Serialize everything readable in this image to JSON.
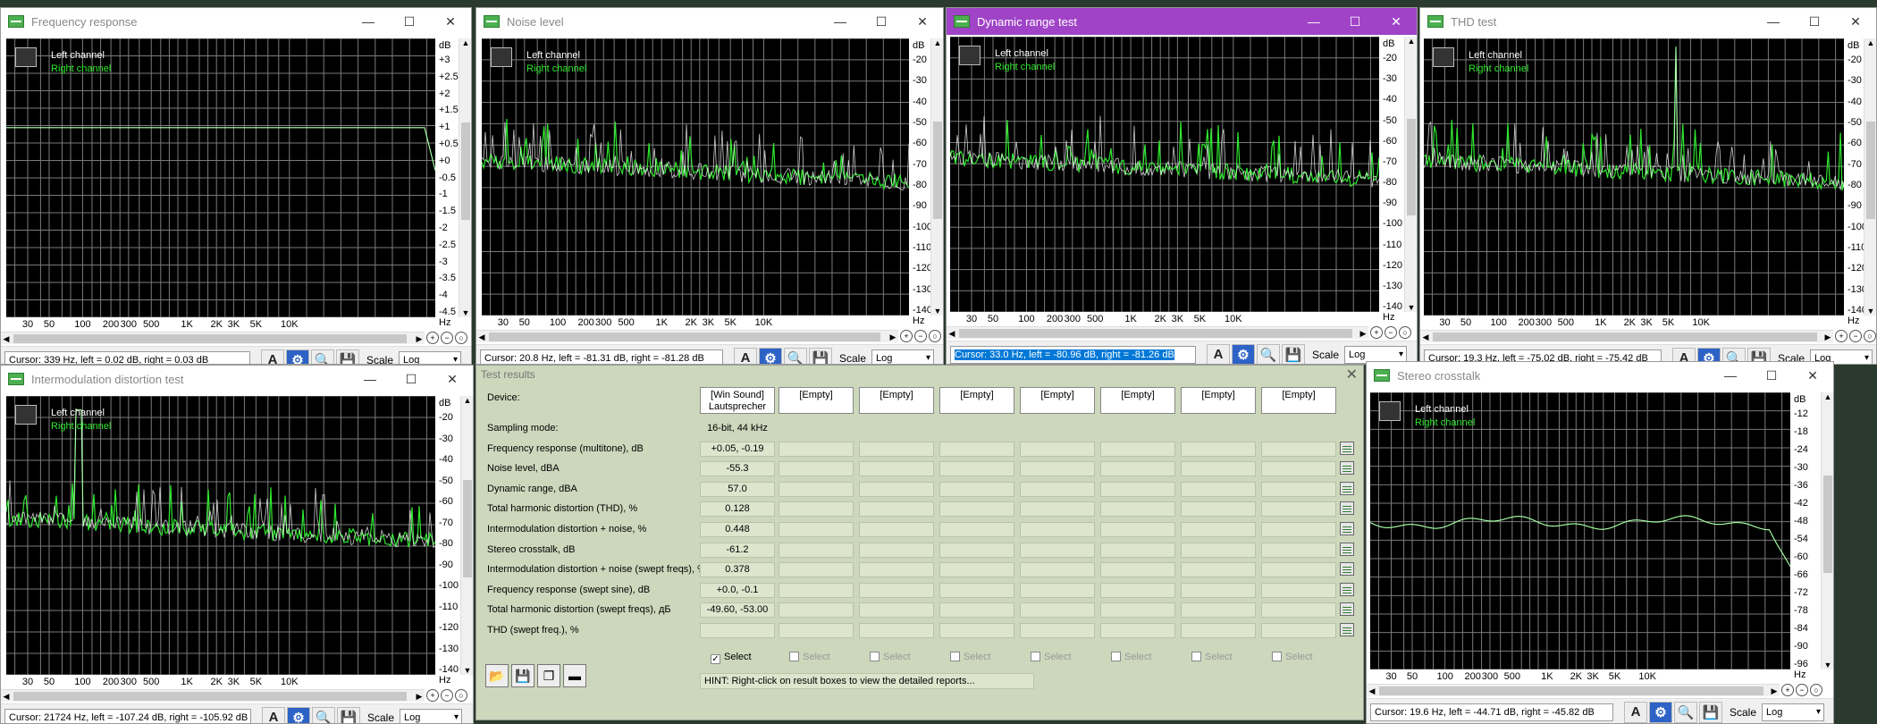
{
  "colors": {
    "plot_bg": "#000000",
    "grid": "#7a7a7a",
    "left_channel": "#ffffff",
    "right_channel": "#2fe82f",
    "active_title": "#a043c7",
    "results_bg": "#cdd7bc"
  },
  "legend": {
    "left": "Left channel",
    "right": "Right channel"
  },
  "scale": {
    "label": "Scale",
    "value": "Log"
  },
  "x_ticks": [
    "30",
    "50",
    "100",
    "200",
    "300",
    "500",
    "1K",
    "2K",
    "3K",
    "5K",
    "10K"
  ],
  "windows": [
    {
      "title": "Frequency response",
      "unit": "dB",
      "y_ticks": [
        "+3",
        "+2.5",
        "+2",
        "+1.5",
        "+1",
        "+0.5",
        "+0",
        "-0.5",
        "-1",
        "-1.5",
        "-2",
        "-2.5",
        "-3",
        "-3.5",
        "-4",
        "-4.5"
      ],
      "cursor": "Cursor:  339 Hz,  left = 0.02 dB,  right = 0.03 dB",
      "hz": "Hz"
    },
    {
      "title": "Noise level",
      "unit": "dB",
      "y_ticks": [
        "-20",
        "-30",
        "-40",
        "-50",
        "-60",
        "-70",
        "-80",
        "-90",
        "-100",
        "-110",
        "-120",
        "-130",
        "-140"
      ],
      "cursor": "Cursor:  20.8 Hz,  left = -81.31 dB,  right = -81.28 dB",
      "hz": "Hz"
    },
    {
      "title": "Dynamic range test",
      "unit": "dB",
      "y_ticks": [
        "-20",
        "-30",
        "-40",
        "-50",
        "-60",
        "-70",
        "-80",
        "-90",
        "-100",
        "-110",
        "-120",
        "-130",
        "-140"
      ],
      "cursor": "Cursor:  33.0 Hz,  left = -80.96 dB,  right = -81.26 dB",
      "hz": "Hz"
    },
    {
      "title": "THD test",
      "unit": "dB",
      "y_ticks": [
        "-20",
        "-30",
        "-40",
        "-50",
        "-60",
        "-70",
        "-80",
        "-90",
        "-100",
        "-110",
        "-120",
        "-130",
        "-140"
      ],
      "cursor": "Cursor:  19.3 Hz,  left = -75.02 dB,  right = -75.42 dB",
      "hz": "Hz"
    },
    {
      "title": "Intermodulation distortion test",
      "unit": "dB",
      "y_ticks": [
        "-20",
        "-30",
        "-40",
        "-50",
        "-60",
        "-70",
        "-80",
        "-90",
        "-100",
        "-110",
        "-120",
        "-130",
        "-140"
      ],
      "cursor": "Cursor:  21724 Hz,  left = -107.24 dB,  right = -105.92 dB",
      "hz": "Hz"
    },
    {
      "title": "Stereo crosstalk",
      "unit": "dB",
      "y_ticks": [
        "-12",
        "-18",
        "-24",
        "-30",
        "-36",
        "-42",
        "-48",
        "-54",
        "-60",
        "-66",
        "-72",
        "-78",
        "-84",
        "-90",
        "-96"
      ],
      "cursor": "Cursor:  19.6 Hz,  left = -44.71 dB,  right = -45.82 dB",
      "hz": "Hz"
    }
  ],
  "results": {
    "title": "Test results",
    "device_label": "Device:",
    "columns": [
      "[Win Sound]\nLautsprecher",
      "[Empty]",
      "[Empty]",
      "[Empty]",
      "[Empty]",
      "[Empty]",
      "[Empty]",
      "[Empty]"
    ],
    "rows": [
      {
        "label": "Sampling mode:",
        "value": "16-bit, 44 kHz"
      },
      {
        "label": "Frequency response (multitone), dB",
        "value": "+0.05, -0.19"
      },
      {
        "label": "Noise level, dBA",
        "value": "-55.3"
      },
      {
        "label": "Dynamic range, dBA",
        "value": "57.0"
      },
      {
        "label": "Total harmonic distortion (THD), %",
        "value": "0.128"
      },
      {
        "label": "Intermodulation distortion + noise, %",
        "value": "0.448"
      },
      {
        "label": "Stereo crosstalk, dB",
        "value": "-61.2"
      },
      {
        "label": "Intermodulation distortion + noise (swept freqs), %",
        "value": "0.378"
      },
      {
        "label": "Frequency response (swept sine), dB",
        "value": "+0.0, -0.1"
      },
      {
        "label": "Total harmonic distortion (swept freqs), дБ",
        "value": "-49.60, -53.00"
      },
      {
        "label": "THD (swept freq.), %",
        "value": ""
      }
    ],
    "select_label": "Select",
    "hint": "HINT: Right-click on result boxes to view the detailed reports..."
  }
}
